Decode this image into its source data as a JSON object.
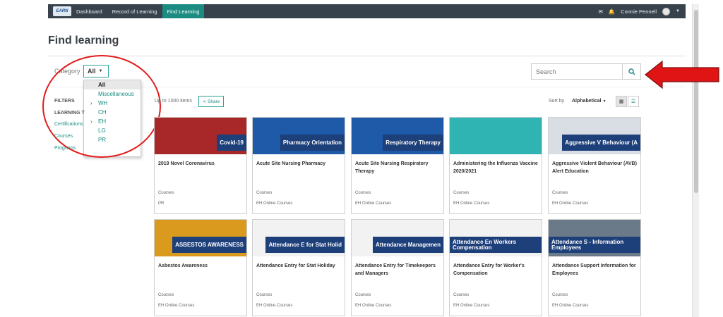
{
  "nav": {
    "logo_text": "EARN",
    "items": [
      "Dashboard",
      "Record of Learning",
      "Find Learning"
    ],
    "user_name": "Connie Pennell"
  },
  "page": {
    "title": "Find learning"
  },
  "category": {
    "label": "Category",
    "selected": "All",
    "options": [
      {
        "label": "All",
        "selected": true,
        "expandable": false
      },
      {
        "label": "Miscellaneous",
        "selected": false,
        "expandable": false
      },
      {
        "label": "WH",
        "selected": false,
        "expandable": true
      },
      {
        "label": "CH",
        "selected": false,
        "expandable": false
      },
      {
        "label": "EH",
        "selected": false,
        "expandable": true
      },
      {
        "label": "LG",
        "selected": false,
        "expandable": false
      },
      {
        "label": "PR",
        "selected": false,
        "expandable": false
      }
    ]
  },
  "search": {
    "placeholder": "Search"
  },
  "filters": {
    "title": "FILTERS",
    "learning_type_label": "LEARNING T",
    "links": [
      "Certifications",
      "Courses",
      "Programs"
    ]
  },
  "results": {
    "count_text": "Up to 1000 items",
    "share_label": "Share"
  },
  "sort": {
    "label": "Sort by",
    "value": "Alphabetical"
  },
  "cards": [
    {
      "title": "2019 Novel Coronavirus",
      "type": "Courses",
      "category": "PR",
      "banner": "Covid-19",
      "bg": "#a8282a"
    },
    {
      "title": "Acute Site Nursing Pharmacy",
      "type": "Courses",
      "category": "EH Online Courses",
      "banner": "Pharmacy Orientation",
      "bg": "#1f5aa8"
    },
    {
      "title": "Acute Site Nursing Respiratory Therapy",
      "type": "Courses",
      "category": "EH Online Courses",
      "banner": "Respiratory Therapy",
      "bg": "#1f5aa8"
    },
    {
      "title": "Administering the Influenza Vaccine 2020/2021",
      "type": "Courses",
      "category": "EH Online Courses",
      "banner": "",
      "bg": "#2fb3b3"
    },
    {
      "title": "Aggressive Violent Behaviour (AVB) Alert Education",
      "type": "Courses",
      "category": "EH Online Courses",
      "banner": "Aggressive V Behaviour (A",
      "bg": "#d9dde4"
    },
    {
      "title": "Asbestos Awareness",
      "type": "Courses",
      "category": "EH Online Courses",
      "banner": "ASBESTOS AWARENESS",
      "bg": "#d99a1e"
    },
    {
      "title": "Attendance Entry for Stat Holiday",
      "type": "Courses",
      "category": "EH Online Courses",
      "banner": "Attendance E for Stat Holid",
      "bg": "#f2f2f2"
    },
    {
      "title": "Attendance Entry for Timekeepers and Managers",
      "type": "Courses",
      "category": "EH Online Courses",
      "banner": "Attendance Managemen",
      "bg": "#f2f2f2"
    },
    {
      "title": "Attendance Entry for Worker's Compensation",
      "type": "Courses",
      "category": "EH Online Courses",
      "banner": "Attendance En Workers Compensation",
      "bg": "#f2f2f2"
    },
    {
      "title": "Attendance Support Information for Employees",
      "type": "Courses",
      "category": "EH Online Courses",
      "banner": "Attendance S - Information Employees",
      "bg": "#6a7a88"
    }
  ]
}
